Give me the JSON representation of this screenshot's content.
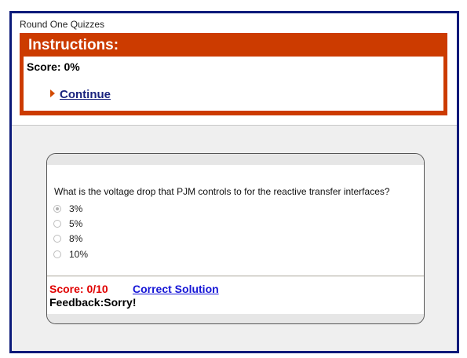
{
  "page": {
    "title": "Round One Quizzes"
  },
  "instructions": {
    "heading": "Instructions:",
    "score": "Score: 0%",
    "continue_label": "Continue"
  },
  "quiz": {
    "question": "What is the voltage drop that PJM controls to for the reactive transfer interfaces?",
    "options": [
      {
        "label": "3%",
        "selected": true
      },
      {
        "label": "5%",
        "selected": false
      },
      {
        "label": "8%",
        "selected": false
      },
      {
        "label": "10%",
        "selected": false
      }
    ],
    "score": "Score: 0/10",
    "solution_label": "Correct Solution",
    "feedback_label": "Feedback:",
    "feedback_value": "Sorry!"
  },
  "colors": {
    "frame_border": "#0c1a7a",
    "instructions_bg": "#cc3b00",
    "score_red": "#e00000",
    "link_blue": "#1515d6"
  }
}
